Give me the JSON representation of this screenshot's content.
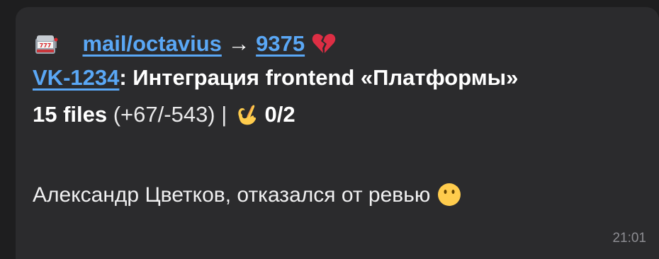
{
  "message": {
    "header": {
      "icon": "slot-machine-icon",
      "repo_link": "mail/octavius",
      "arrow": "→",
      "pr_link": "9375",
      "status_icon": "broken-heart-icon"
    },
    "title": {
      "issue_link": "VK-1234",
      "text": ": Интеграция frontend «Платформы»"
    },
    "stats": {
      "files": "15 files",
      "diff": " (+67/-543) | ",
      "approval_icon": "ok-hand-icon",
      "approvals": "0/2"
    },
    "body": {
      "text": "Александр Цветков, отказался от ревью",
      "icon": "neutral-face-icon"
    },
    "time": "21:01"
  }
}
